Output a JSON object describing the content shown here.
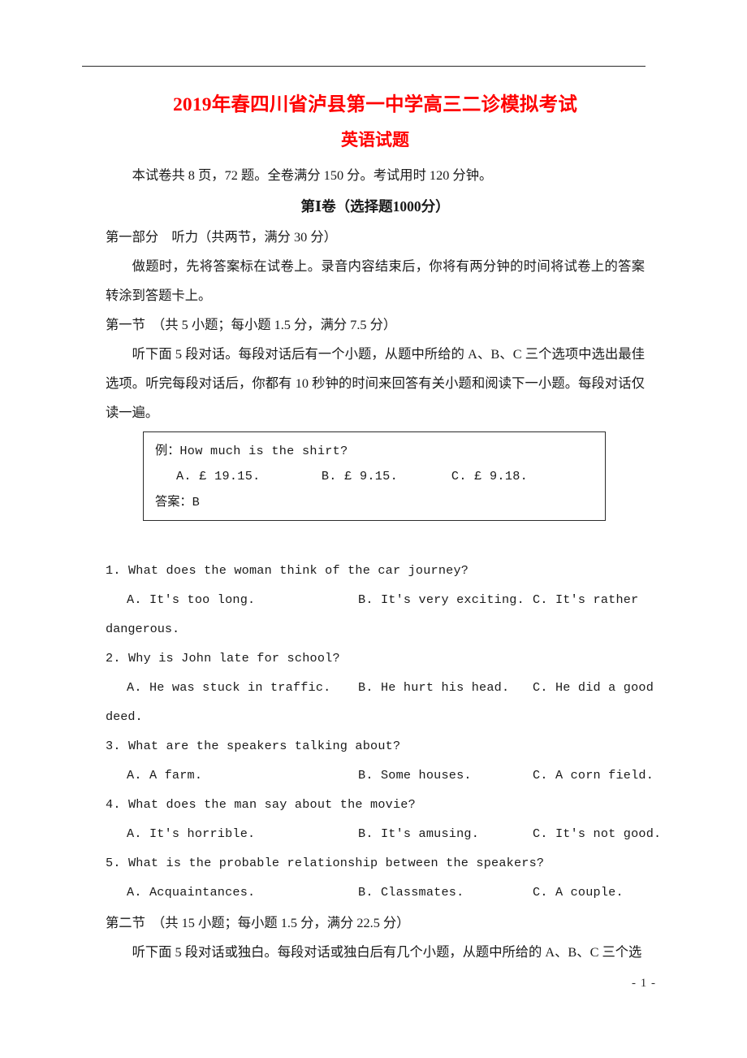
{
  "document": {
    "title": "2019年春四川省泸县第一中学高三二诊模拟考试",
    "subtitle": "英语试题",
    "exam_info": "本试卷共 8 页，72 题。全卷满分 150 分。考试用时 120 分钟。",
    "volume_heading": "第Ⅰ卷（选择题1000分）",
    "part_one": "第一部分　听力（共两节，满分 30 分）",
    "instruction_general": "做题时，先将答案标在试卷上。录音内容结束后，你将有两分钟的时间将试卷上的答案转涂到答题卡上。",
    "section_one_heading": "第一节　（共 5 小题；每小题 1.5 分，满分 7.5 分）",
    "section_one_instruction": "听下面 5 段对话。每段对话后有一个小题，从题中所给的 A、B、C 三个选项中选出最佳选项。听完每段对话后，你都有 10 秒钟的时间来回答有关小题和阅读下一小题。每段对话仅读一遍。",
    "page_number": "- 1 -"
  },
  "example_box": {
    "prompt_label": "例：",
    "prompt_text": "How much is the shirt?",
    "options": [
      "A. £ 19.15.",
      "B. £ 9.15.",
      "C. £ 9.18."
    ],
    "answer_label": "答案：",
    "answer_value": "B"
  },
  "questions": [
    {
      "number": "1.",
      "stem": "What does the woman think of the car journey?",
      "options": [
        "A. It's too long.",
        "B. It's very exciting.",
        "C. It's rather dangerous."
      ],
      "opt_a": "A. It's too long.",
      "opt_b": "B. It's very exciting.",
      "opt_c_head": "C.  It's  rather",
      "opt_c_tail": "dangerous."
    },
    {
      "number": "2.",
      "stem": "Why is John late for school?",
      "options": [
        "A. He was stuck in traffic.",
        "B. He hurt his head.",
        "C. He did a good deed."
      ],
      "opt_a": "A. He was stuck in traffic.",
      "opt_b": "B. He hurt his head.",
      "opt_c_head": "C.  He did a good",
      "opt_c_tail": "deed."
    },
    {
      "number": "3.",
      "stem": "What are the speakers talking about?",
      "options": [
        "A. A farm.",
        "B. Some houses.",
        "C. A corn field."
      ],
      "opt_a": "A. A farm.",
      "opt_b": "B. Some houses.",
      "opt_c": "C. A corn field."
    },
    {
      "number": "4.",
      "stem": "What does the man say about the movie?",
      "options": [
        "A. It's horrible.",
        "B. It's amusing.",
        "C. It's not good."
      ],
      "opt_a": "A. It's horrible.",
      "opt_b": "B. It's amusing.",
      "opt_c": "C. It's not good."
    },
    {
      "number": "5.",
      "stem": "What is the probable relationship between the speakers?",
      "options": [
        "A. Acquaintances.",
        "B. Classmates.",
        "C. A couple."
      ],
      "opt_a": "A. Acquaintances.",
      "opt_b": "B. Classmates.",
      "opt_c": "C. A couple."
    }
  ],
  "section_two": {
    "heading": "第二节　（共 15 小题；每小题 1.5 分，满分 22.5 分）",
    "instruction": "听下面 5 段对话或独白。每段对话或独白后有几个小题，从题中所给的 A、B、C 三个选"
  },
  "colors": {
    "title_red": "#ff0000",
    "body_text": "#1a1a1a",
    "rule": "#2b2b2b"
  }
}
